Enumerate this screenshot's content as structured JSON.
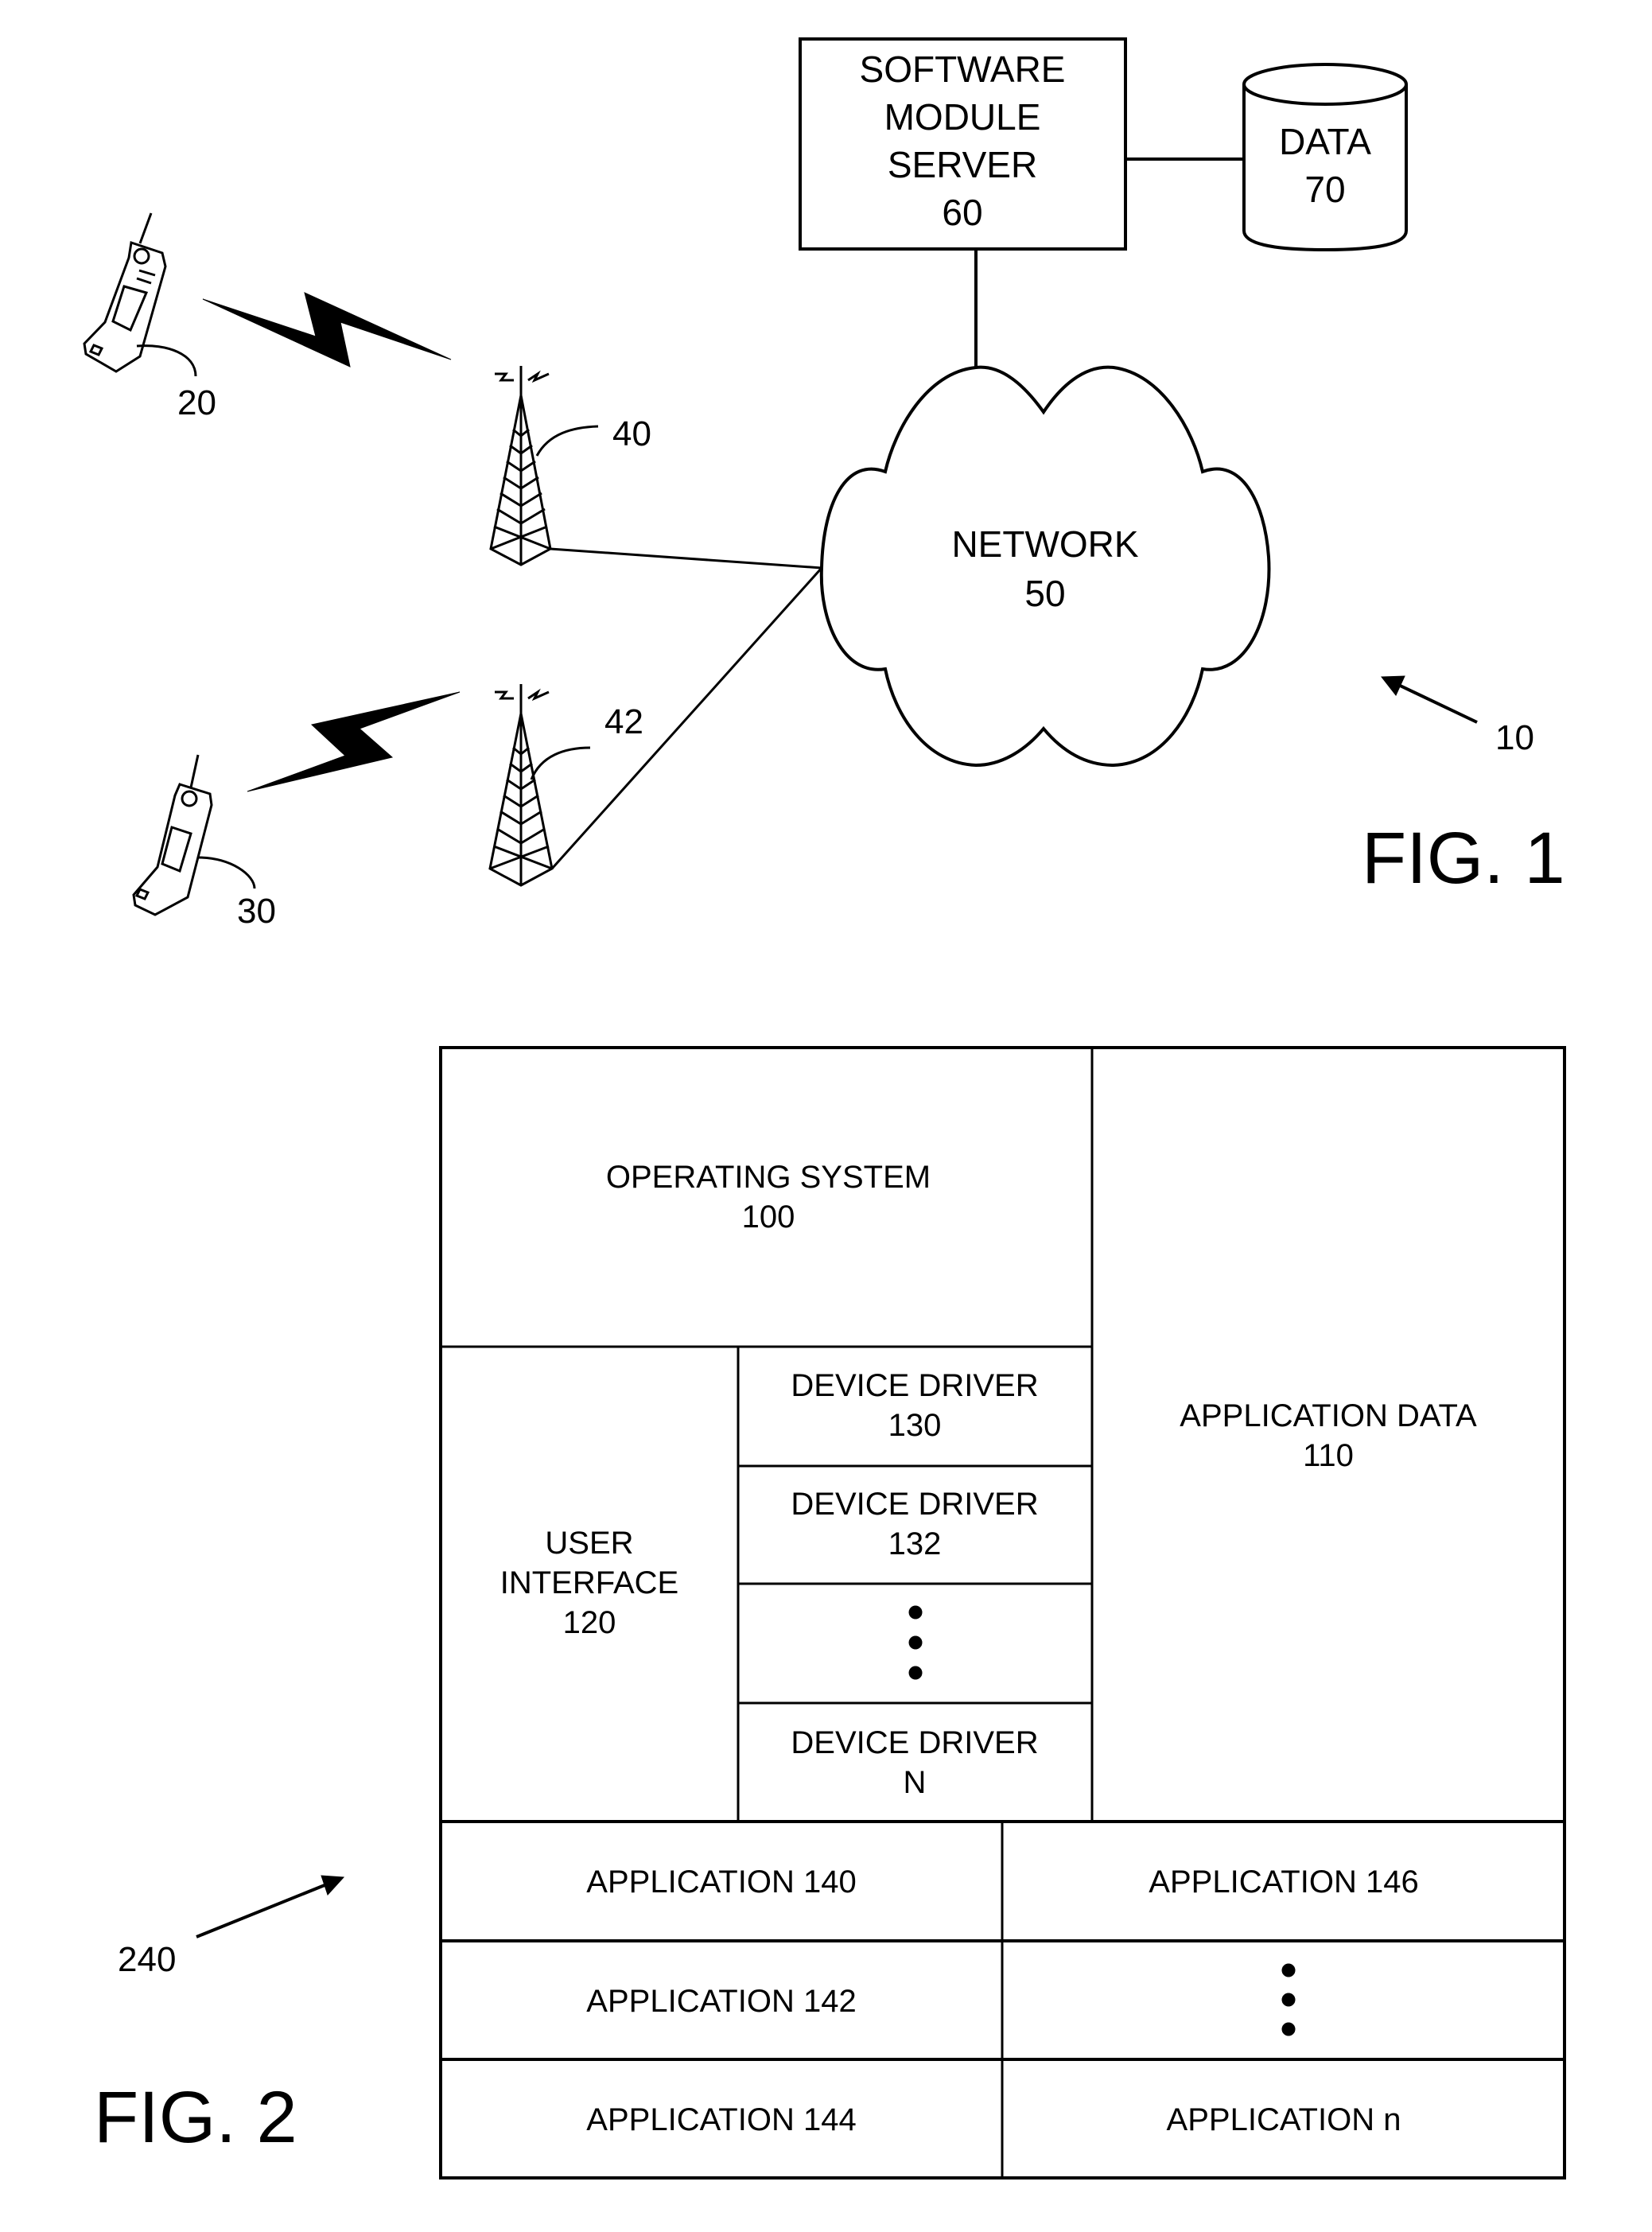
{
  "fig1": {
    "caption": "FIG. 1",
    "system_ref": "10",
    "server": {
      "lines": [
        "SOFTWARE",
        "MODULE",
        "SERVER",
        "60"
      ]
    },
    "data_store": {
      "lines": [
        "DATA",
        "70"
      ]
    },
    "network": {
      "lines": [
        "NETWORK",
        "50"
      ]
    },
    "mobile_devices": [
      {
        "ref": "20",
        "icon": "mobile-phone-icon"
      },
      {
        "ref": "30",
        "icon": "mobile-phone-icon"
      }
    ],
    "towers": [
      {
        "ref": "40",
        "icon": "cell-tower-icon"
      },
      {
        "ref": "42",
        "icon": "cell-tower-icon"
      }
    ],
    "wireless_links": [
      {
        "icon": "lightning-bolt-icon",
        "from": "20",
        "to": "40"
      },
      {
        "icon": "lightning-bolt-icon",
        "from": "30",
        "to": "42"
      }
    ]
  },
  "fig2": {
    "caption": "FIG. 2",
    "system_ref": "240",
    "operating_system": {
      "lines": [
        "OPERATING SYSTEM",
        "100"
      ]
    },
    "application_data": {
      "lines": [
        "APPLICATION DATA",
        "110"
      ]
    },
    "user_interface": {
      "lines": [
        "USER",
        "INTERFACE",
        "120"
      ]
    },
    "device_drivers": [
      {
        "lines": [
          "DEVICE DRIVER",
          "130"
        ]
      },
      {
        "lines": [
          "DEVICE DRIVER",
          "132"
        ]
      },
      {
        "lines": [
          "•",
          "•",
          "•"
        ],
        "ellipsis": true
      },
      {
        "lines": [
          "DEVICE DRIVER",
          "N"
        ]
      }
    ],
    "applications_left": [
      "APPLICATION 140",
      "APPLICATION 142",
      "APPLICATION 144"
    ],
    "applications_right": [
      "APPLICATION 146",
      "⋮",
      "APPLICATION n"
    ]
  }
}
